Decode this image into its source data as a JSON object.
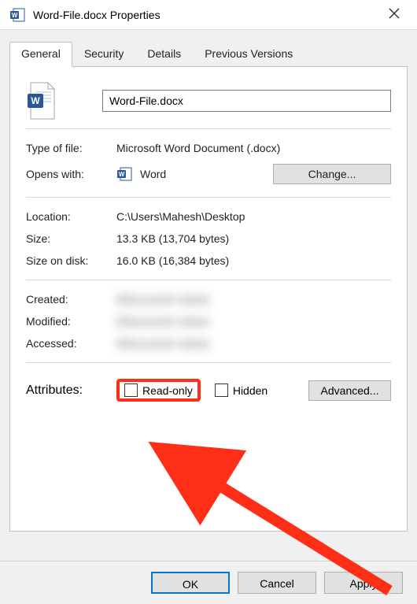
{
  "titlebar": {
    "title": "Word-File.docx Properties"
  },
  "tabs": {
    "general": "General",
    "security": "Security",
    "details": "Details",
    "previous_versions": "Previous Versions"
  },
  "general": {
    "filename": "Word-File.docx",
    "type_of_file_lbl": "Type of file:",
    "type_of_file": "Microsoft Word Document (.docx)",
    "opens_with_lbl": "Opens with:",
    "opens_with_app": "Word",
    "change_btn": "Change...",
    "location_lbl": "Location:",
    "location": "C:\\Users\\Mahesh\\Desktop",
    "size_lbl": "Size:",
    "size": "13.3 KB (13,704 bytes)",
    "size_on_disk_lbl": "Size on disk:",
    "size_on_disk": "16.0 KB (16,384 bytes)",
    "created_lbl": "Created:",
    "created": "Obscured value",
    "modified_lbl": "Modified:",
    "modified": "Obscured value",
    "accessed_lbl": "Accessed:",
    "accessed": "Obscured value",
    "attributes_lbl": "Attributes:",
    "read_only_label": "Read-only",
    "hidden_label": "Hidden",
    "advanced_btn": "Advanced..."
  },
  "buttons": {
    "ok": "OK",
    "cancel": "Cancel",
    "apply": "Apply"
  }
}
